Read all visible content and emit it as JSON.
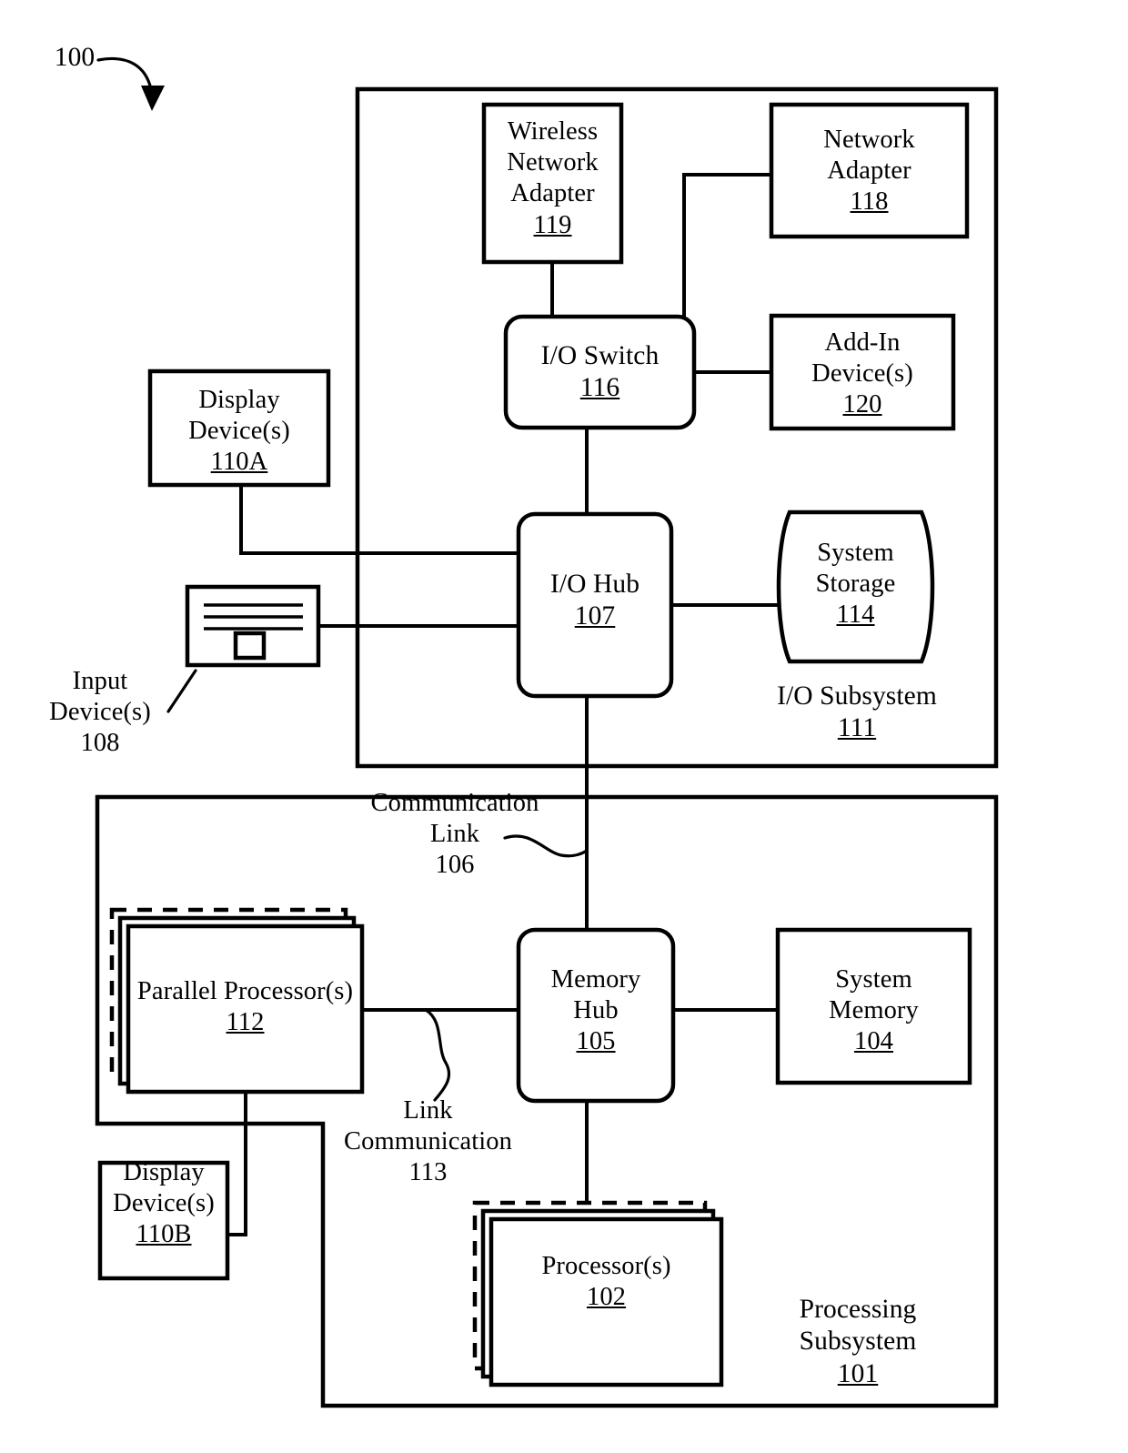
{
  "figure": {
    "ref_label": "100",
    "arrow_icon": "curved-arrow-icon"
  },
  "io_subsystem": {
    "name_line1": "I/O Subsystem",
    "ref": "111",
    "blocks": {
      "wireless_network_adapter": {
        "line1": "Wireless",
        "line2": "Network",
        "line3": "Adapter",
        "ref": "119"
      },
      "network_adapter": {
        "line1": "Network",
        "line2": "Adapter",
        "ref": "118"
      },
      "io_switch": {
        "line1": "I/O Switch",
        "ref": "116"
      },
      "add_in_devices": {
        "line1": "Add-In",
        "line2": "Device(s)",
        "ref": "120"
      },
      "io_hub": {
        "line1": "I/O Hub",
        "ref": "107"
      },
      "system_storage": {
        "line1": "System",
        "line2": "Storage",
        "ref": "114"
      }
    }
  },
  "external_devices": {
    "display_device_a": {
      "line1": "Display",
      "line2": "Device(s)",
      "ref": "110A"
    },
    "input_devices": {
      "line1": "Input",
      "line2": "Device(s)",
      "ref": "108",
      "icon": "keyboard-icon"
    }
  },
  "links": {
    "communication_link_106": {
      "line1": "Communication",
      "line2": "Link",
      "ref": "106"
    },
    "link_communication_113": {
      "line1": "Link",
      "line2": "Communication",
      "ref": "113"
    }
  },
  "processing_subsystem": {
    "name_line1": "Processing Subsystem",
    "ref": "101",
    "blocks": {
      "parallel_processors": {
        "line1": "Parallel Processor(s)",
        "ref": "112"
      },
      "memory_hub": {
        "line1": "Memory",
        "line2": "Hub",
        "ref": "105"
      },
      "system_memory": {
        "line1": "System",
        "line2": "Memory",
        "ref": "104"
      },
      "processors": {
        "line1": "Processor(s)",
        "ref": "102"
      },
      "display_device_b": {
        "line1": "Display",
        "line2": "Device(s)",
        "ref": "110B"
      }
    }
  },
  "colors": {
    "ink": "#000000",
    "paper": "#ffffff"
  }
}
